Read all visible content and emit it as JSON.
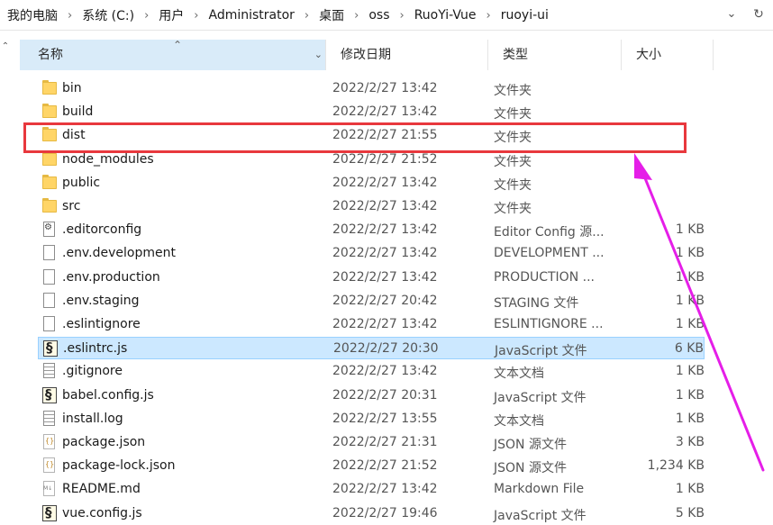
{
  "breadcrumb": [
    "我的电脑",
    "系统 (C:)",
    "用户",
    "Administrator",
    "桌面",
    "oss",
    "RuoYi-Vue",
    "ruoyi-ui"
  ],
  "breadcrumb_separator": "›",
  "columns": {
    "name": "名称",
    "date": "修改日期",
    "type": "类型",
    "size": "大小"
  },
  "files": [
    {
      "name": "bin",
      "date": "2022/2/27 13:42",
      "type": "文件夹",
      "size": "",
      "icon": "folder-icon"
    },
    {
      "name": "build",
      "date": "2022/2/27 13:42",
      "type": "文件夹",
      "size": "",
      "icon": "folder-icon"
    },
    {
      "name": "dist",
      "date": "2022/2/27 21:55",
      "type": "文件夹",
      "size": "",
      "icon": "folder-icon"
    },
    {
      "name": "node_modules",
      "date": "2022/2/27 21:52",
      "type": "文件夹",
      "size": "",
      "icon": "folder-icon"
    },
    {
      "name": "public",
      "date": "2022/2/27 13:42",
      "type": "文件夹",
      "size": "",
      "icon": "folder-icon"
    },
    {
      "name": "src",
      "date": "2022/2/27 13:42",
      "type": "文件夹",
      "size": "",
      "icon": "folder-icon"
    },
    {
      "name": ".editorconfig",
      "date": "2022/2/27 13:42",
      "type": "Editor Config 源...",
      "size": "1 KB",
      "icon": "config-file-icon"
    },
    {
      "name": ".env.development",
      "date": "2022/2/27 13:42",
      "type": "DEVELOPMENT ...",
      "size": "1 KB",
      "icon": "blank-file-icon"
    },
    {
      "name": ".env.production",
      "date": "2022/2/27 13:42",
      "type": "PRODUCTION ...",
      "size": "1 KB",
      "icon": "blank-file-icon"
    },
    {
      "name": ".env.staging",
      "date": "2022/2/27 20:42",
      "type": "STAGING 文件",
      "size": "1 KB",
      "icon": "blank-file-icon"
    },
    {
      "name": ".eslintignore",
      "date": "2022/2/27 13:42",
      "type": "ESLINTIGNORE ...",
      "size": "1 KB",
      "icon": "blank-file-icon"
    },
    {
      "name": ".eslintrc.js",
      "date": "2022/2/27 20:30",
      "type": "JavaScript 文件",
      "size": "6 KB",
      "icon": "javascript-file-icon"
    },
    {
      "name": ".gitignore",
      "date": "2022/2/27 13:42",
      "type": "文本文档",
      "size": "1 KB",
      "icon": "text-file-icon"
    },
    {
      "name": "babel.config.js",
      "date": "2022/2/27 20:31",
      "type": "JavaScript 文件",
      "size": "1 KB",
      "icon": "javascript-file-icon"
    },
    {
      "name": "install.log",
      "date": "2022/2/27 13:55",
      "type": "文本文档",
      "size": "1 KB",
      "icon": "text-file-icon"
    },
    {
      "name": "package.json",
      "date": "2022/2/27 21:31",
      "type": "JSON 源文件",
      "size": "3 KB",
      "icon": "json-file-icon"
    },
    {
      "name": "package-lock.json",
      "date": "2022/2/27 21:52",
      "type": "JSON 源文件",
      "size": "1,234 KB",
      "icon": "json-file-icon"
    },
    {
      "name": "README.md",
      "date": "2022/2/27 13:42",
      "type": "Markdown File",
      "size": "1 KB",
      "icon": "markdown-file-icon"
    },
    {
      "name": "vue.config.js",
      "date": "2022/2/27 19:46",
      "type": "JavaScript 文件",
      "size": "5 KB",
      "icon": "javascript-file-icon"
    }
  ],
  "selected_file": ".eslintrc.js",
  "highlighted_file": "dist",
  "colors": {
    "highlight_box": "#e8383d",
    "arrow": "#e51ee8",
    "selection": "#cce8ff",
    "sorted_header": "#d9ebf9"
  }
}
